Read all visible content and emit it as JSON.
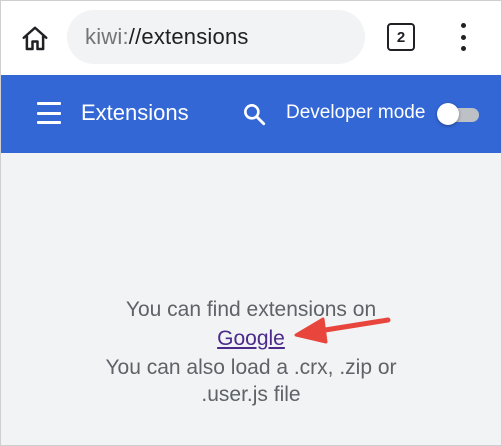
{
  "browser": {
    "url_scheme": "kiwi:",
    "url_path": "//extensions",
    "tab_count": "2"
  },
  "header": {
    "title": "Extensions",
    "developer_mode_label": "Developer mode",
    "developer_mode_on": false
  },
  "content": {
    "line1": "You can find extensions on",
    "link_text": "Google",
    "line2": "You can also load a .crx, .zip or",
    "line3": ".user.js file"
  },
  "colors": {
    "header_bg": "#3367d6",
    "link": "#4b2a8c",
    "annotation_arrow": "#e8453c"
  }
}
